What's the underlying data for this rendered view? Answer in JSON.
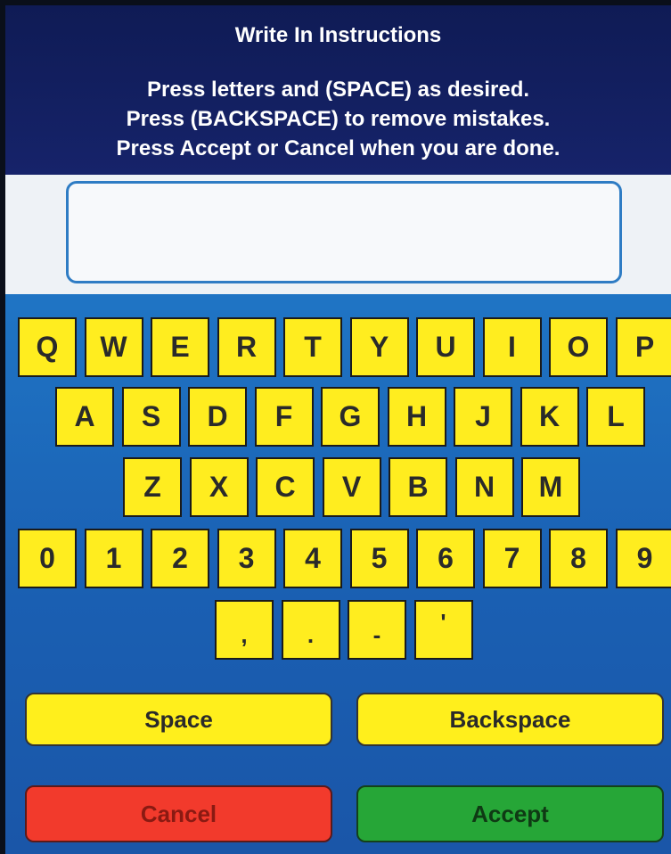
{
  "header": {
    "title": "Write In Instructions",
    "instructions": [
      "Press letters and (SPACE) as desired.",
      "Press (BACKSPACE) to remove mistakes.",
      "Press Accept or Cancel when you are done."
    ]
  },
  "write_in": {
    "value": ""
  },
  "keyboard": {
    "row1": [
      "Q",
      "W",
      "E",
      "R",
      "T",
      "Y",
      "U",
      "I",
      "O",
      "P"
    ],
    "row2": [
      "A",
      "S",
      "D",
      "F",
      "G",
      "H",
      "J",
      "K",
      "L"
    ],
    "row3": [
      "Z",
      "X",
      "C",
      "V",
      "B",
      "N",
      "M"
    ],
    "row4": [
      "0",
      "1",
      "2",
      "3",
      "4",
      "5",
      "6",
      "7",
      "8",
      "9"
    ],
    "row5": [
      ",",
      ".",
      "-",
      "'"
    ]
  },
  "buttons": {
    "space": "Space",
    "backspace": "Backspace",
    "cancel": "Cancel",
    "accept": "Accept"
  },
  "colors": {
    "key_yellow": "#ffed1f",
    "cancel_red": "#f23a2c",
    "accept_green": "#26a637",
    "header_navy": "#16236a",
    "background_blue": "#1f74c4"
  }
}
